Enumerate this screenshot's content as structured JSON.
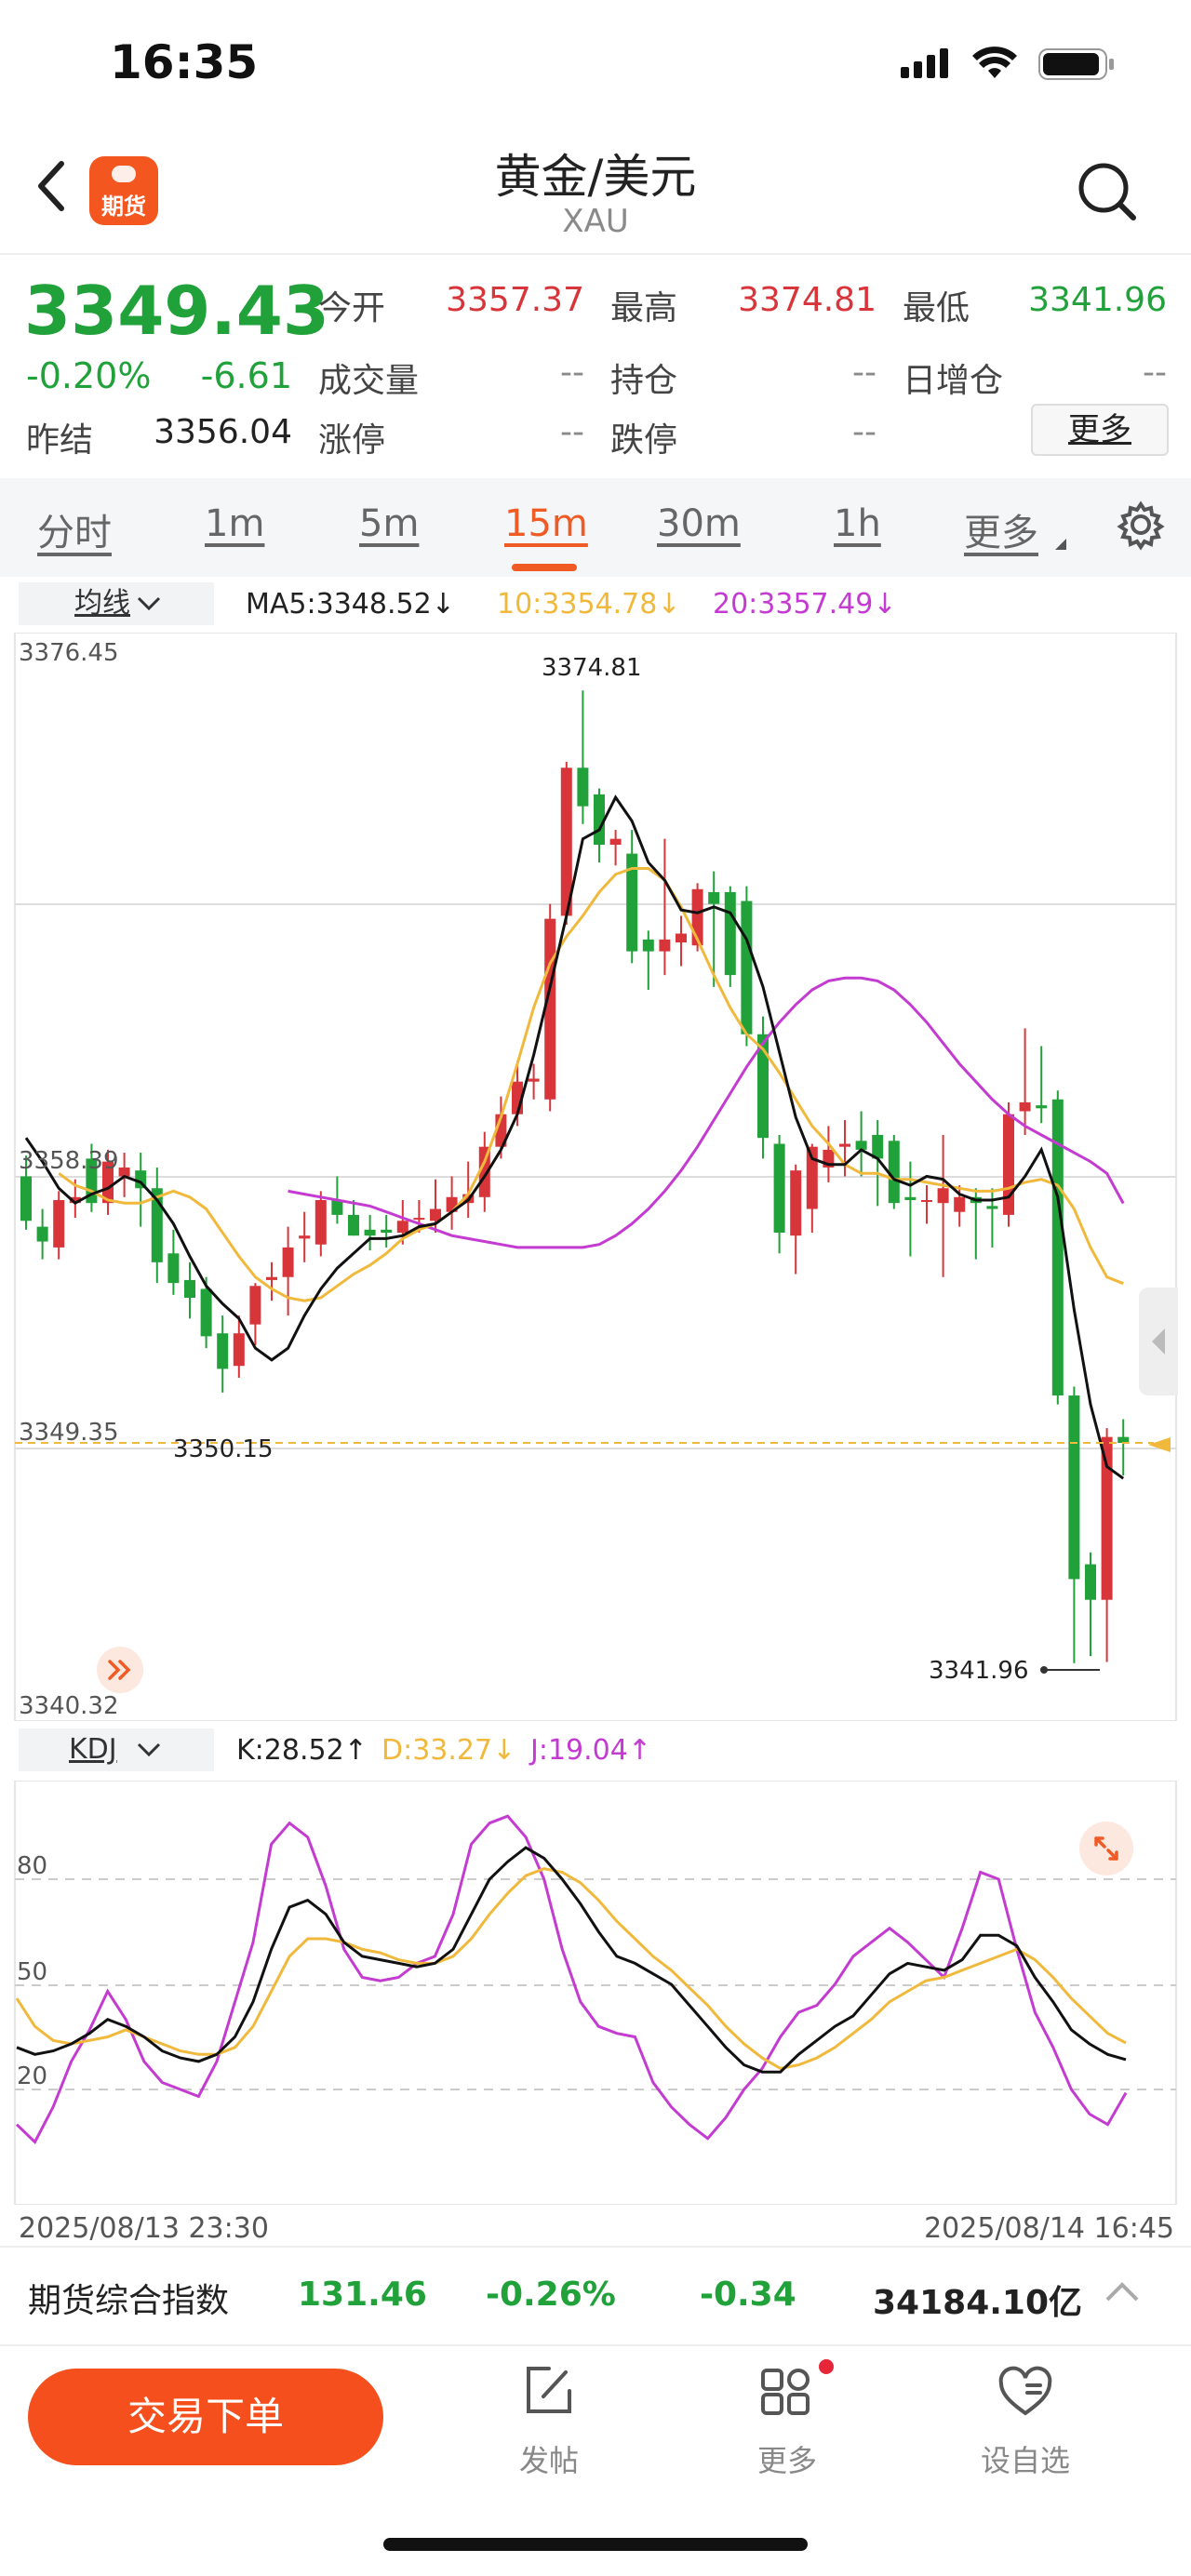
{
  "status_bar": {
    "time": "16:35"
  },
  "header": {
    "title": "黄金/美元",
    "subtitle": "XAU",
    "badge_label": "期货"
  },
  "quote": {
    "price": "3349.43",
    "change_pct": "-0.20%",
    "change": "-6.61",
    "prev_settle_label": "昨结",
    "prev_settle": "3356.04",
    "open_label": "今开",
    "open": "3357.37",
    "high_label": "最高",
    "high": "3374.81",
    "low_label": "最低",
    "low": "3341.96",
    "volume_label": "成交量",
    "volume": "--",
    "position_label": "持仓",
    "position": "--",
    "daily_inc_label": "日增仓",
    "daily_inc": "--",
    "limit_up_label": "涨停",
    "limit_up": "--",
    "limit_down_label": "跌停",
    "limit_down": "--",
    "more_label": "更多"
  },
  "tabs": [
    "分时",
    "1m",
    "5m",
    "15m",
    "30m",
    "1h",
    "更多"
  ],
  "active_tab": "15m",
  "main_chart": {
    "indicator_label": "均线",
    "ma5": "MA5:3348.52↓",
    "ma10": "10:3354.78↓",
    "ma20": "20:3357.49↓",
    "y_top": "3376.45",
    "y_mid": "3358.39",
    "y_low_ref": "3349.35",
    "y_bottom": "3340.32",
    "high_mark": "3374.81",
    "low_mark": "3341.96",
    "left_mark": "3350.15"
  },
  "sub_chart": {
    "indicator_label": "KDJ",
    "k": "K:28.52↑",
    "d": "D:33.27↓",
    "j": "J:19.04↑",
    "levels": [
      "80",
      "50",
      "20"
    ]
  },
  "time_axis": {
    "start": "2025/08/13 23:30",
    "end": "2025/08/14 16:45"
  },
  "index_bar": {
    "name": "期货综合指数",
    "value": "131.46",
    "pct": "-0.26%",
    "change": "-0.34",
    "turnover": "34184.10亿"
  },
  "bottom_nav": {
    "trade": "交易下单",
    "post": "发帖",
    "more": "更多",
    "watchlist": "设自选"
  },
  "colors": {
    "up": "#d8353a",
    "down": "#21a13a",
    "accent": "#f05a24",
    "ma10": "#f0b93c",
    "ma20": "#c43bd1"
  },
  "chart_data": [
    {
      "type": "candlestick",
      "title": "",
      "ylim": [
        3340.32,
        3376.45
      ],
      "candles": [
        {
          "o": 3358.4,
          "c": 3356.9,
          "h": 3359.1,
          "l": 3356.6
        },
        {
          "o": 3356.7,
          "c": 3356.2,
          "h": 3357.3,
          "l": 3355.6
        },
        {
          "o": 3356.0,
          "c": 3357.6,
          "h": 3357.9,
          "l": 3355.6
        },
        {
          "o": 3357.5,
          "c": 3357.7,
          "h": 3358.3,
          "l": 3357.0
        },
        {
          "o": 3359.0,
          "c": 3357.5,
          "h": 3359.5,
          "l": 3357.2
        },
        {
          "o": 3357.5,
          "c": 3358.9,
          "h": 3359.3,
          "l": 3357.1
        },
        {
          "o": 3358.4,
          "c": 3358.7,
          "h": 3359.2,
          "l": 3357.7
        },
        {
          "o": 3358.6,
          "c": 3358.0,
          "h": 3359.2,
          "l": 3356.7
        },
        {
          "o": 3358.0,
          "c": 3355.5,
          "h": 3358.7,
          "l": 3354.8
        },
        {
          "o": 3355.8,
          "c": 3354.8,
          "h": 3356.6,
          "l": 3354.4
        },
        {
          "o": 3354.9,
          "c": 3354.3,
          "h": 3355.5,
          "l": 3353.6
        },
        {
          "o": 3354.6,
          "c": 3353.0,
          "h": 3355.0,
          "l": 3352.6
        },
        {
          "o": 3353.1,
          "c": 3351.9,
          "h": 3353.7,
          "l": 3351.1
        },
        {
          "o": 3352.0,
          "c": 3353.1,
          "h": 3353.7,
          "l": 3351.6
        },
        {
          "o": 3353.4,
          "c": 3354.7,
          "h": 3354.8,
          "l": 3352.7
        },
        {
          "o": 3354.9,
          "c": 3355.0,
          "h": 3355.5,
          "l": 3354.2
        },
        {
          "o": 3355.0,
          "c": 3356.0,
          "h": 3356.7,
          "l": 3353.7
        },
        {
          "o": 3356.3,
          "c": 3356.4,
          "h": 3357.2,
          "l": 3355.5
        },
        {
          "o": 3356.1,
          "c": 3357.6,
          "h": 3357.9,
          "l": 3355.7
        },
        {
          "o": 3357.6,
          "c": 3357.1,
          "h": 3358.4,
          "l": 3356.8
        },
        {
          "o": 3357.1,
          "c": 3356.4,
          "h": 3357.6,
          "l": 3356.4
        },
        {
          "o": 3356.6,
          "c": 3356.4,
          "h": 3357.1,
          "l": 3355.9
        },
        {
          "o": 3356.6,
          "c": 3356.5,
          "h": 3357.1,
          "l": 3356.0
        },
        {
          "o": 3356.5,
          "c": 3356.9,
          "h": 3357.6,
          "l": 3356.1
        },
        {
          "o": 3357.0,
          "c": 3357.0,
          "h": 3357.6,
          "l": 3356.5
        },
        {
          "o": 3356.9,
          "c": 3357.3,
          "h": 3358.3,
          "l": 3356.5
        },
        {
          "o": 3357.2,
          "c": 3357.7,
          "h": 3358.4,
          "l": 3356.6
        },
        {
          "o": 3357.5,
          "c": 3357.8,
          "h": 3358.9,
          "l": 3357.0
        },
        {
          "o": 3357.7,
          "c": 3359.4,
          "h": 3359.9,
          "l": 3357.2
        },
        {
          "o": 3359.4,
          "c": 3360.5,
          "h": 3361.1,
          "l": 3359.0
        },
        {
          "o": 3360.5,
          "c": 3361.6,
          "h": 3362.3,
          "l": 3360.1
        },
        {
          "o": 3361.6,
          "c": 3361.7,
          "h": 3362.2,
          "l": 3361.0
        },
        {
          "o": 3361.0,
          "c": 3367.1,
          "h": 3367.6,
          "l": 3360.6
        },
        {
          "o": 3367.2,
          "c": 3372.2,
          "h": 3372.4,
          "l": 3366.9
        },
        {
          "o": 3372.2,
          "c": 3370.9,
          "h": 3374.81,
          "l": 3370.3
        },
        {
          "o": 3371.3,
          "c": 3369.6,
          "h": 3371.5,
          "l": 3369.0
        },
        {
          "o": 3369.6,
          "c": 3369.8,
          "h": 3370.1,
          "l": 3368.9
        },
        {
          "o": 3369.3,
          "c": 3366.0,
          "h": 3370.1,
          "l": 3365.6
        },
        {
          "o": 3366.4,
          "c": 3366.0,
          "h": 3366.7,
          "l": 3364.7
        },
        {
          "o": 3366.0,
          "c": 3366.4,
          "h": 3369.8,
          "l": 3365.2
        },
        {
          "o": 3366.3,
          "c": 3366.6,
          "h": 3367.2,
          "l": 3365.5
        },
        {
          "o": 3366.2,
          "c": 3368.1,
          "h": 3368.3,
          "l": 3366.0
        },
        {
          "o": 3368.0,
          "c": 3367.6,
          "h": 3368.7,
          "l": 3364.8
        },
        {
          "o": 3368.0,
          "c": 3365.2,
          "h": 3368.2,
          "l": 3364.8
        },
        {
          "o": 3367.7,
          "c": 3363.2,
          "h": 3368.2,
          "l": 3362.8
        },
        {
          "o": 3363.2,
          "c": 3359.7,
          "h": 3363.8,
          "l": 3359.0
        },
        {
          "o": 3359.5,
          "c": 3356.5,
          "h": 3359.8,
          "l": 3355.8
        },
        {
          "o": 3356.4,
          "c": 3358.6,
          "h": 3358.8,
          "l": 3355.1
        },
        {
          "o": 3357.3,
          "c": 3359.4,
          "h": 3359.5,
          "l": 3356.5
        },
        {
          "o": 3358.7,
          "c": 3359.3,
          "h": 3360.1,
          "l": 3358.2
        },
        {
          "o": 3359.4,
          "c": 3359.5,
          "h": 3360.3,
          "l": 3358.4
        },
        {
          "o": 3359.6,
          "c": 3359.3,
          "h": 3360.6,
          "l": 3358.4
        },
        {
          "o": 3359.8,
          "c": 3359.0,
          "h": 3360.3,
          "l": 3357.4
        },
        {
          "o": 3359.6,
          "c": 3357.5,
          "h": 3359.8,
          "l": 3357.3
        },
        {
          "o": 3357.7,
          "c": 3357.6,
          "h": 3358.9,
          "l": 3355.7
        },
        {
          "o": 3357.6,
          "c": 3357.6,
          "h": 3358.1,
          "l": 3356.8
        },
        {
          "o": 3357.5,
          "c": 3358.0,
          "h": 3359.8,
          "l": 3355.0
        },
        {
          "o": 3357.2,
          "c": 3357.7,
          "h": 3358.1,
          "l": 3356.7
        },
        {
          "o": 3357.7,
          "c": 3357.5,
          "h": 3358.0,
          "l": 3355.6
        },
        {
          "o": 3357.4,
          "c": 3357.3,
          "h": 3358.0,
          "l": 3356.0
        },
        {
          "o": 3357.1,
          "c": 3360.5,
          "h": 3360.9,
          "l": 3356.7
        },
        {
          "o": 3360.6,
          "c": 3360.9,
          "h": 3363.4,
          "l": 3359.8
        },
        {
          "o": 3360.8,
          "c": 3360.7,
          "h": 3362.8,
          "l": 3360.2
        },
        {
          "o": 3361.0,
          "c": 3351.0,
          "h": 3361.3,
          "l": 3350.7
        },
        {
          "o": 3351.0,
          "c": 3344.8,
          "h": 3351.3,
          "l": 3341.96
        },
        {
          "o": 3345.3,
          "c": 3344.1,
          "h": 3345.7,
          "l": 3342.2
        },
        {
          "o": 3344.1,
          "c": 3349.6,
          "h": 3349.9,
          "l": 3342.0
        },
        {
          "o": 3349.6,
          "c": 3349.4,
          "h": 3350.2,
          "l": 3348.3
        }
      ],
      "series": [
        {
          "name": "MA5",
          "values": [
            3359.7,
            3358.9,
            3358.0,
            3357.5,
            3357.8,
            3358.0,
            3358.4,
            3358.2,
            3357.6,
            3356.8,
            3355.7,
            3354.7,
            3354.1,
            3353.6,
            3352.6,
            3352.2,
            3352.6,
            3353.7,
            3354.6,
            3355.3,
            3355.8,
            3356.3,
            3356.3,
            3356.4,
            3356.7,
            3356.8,
            3357.2,
            3357.6,
            3358.4,
            3359.3,
            3360.5,
            3362.5,
            3364.8,
            3367.2,
            3369.8,
            3370.1,
            3371.2,
            3370.4,
            3369.0,
            3368.4,
            3367.4,
            3367.3,
            3367.5,
            3367.3,
            3366.4,
            3364.8,
            3362.6,
            3360.4,
            3359.0,
            3358.8,
            3358.8,
            3359.3,
            3359.0,
            3358.3,
            3358.1,
            3358.4,
            3358.3,
            3357.8,
            3357.6,
            3357.6,
            3357.7,
            3358.4,
            3359.3,
            3357.7,
            3353.9,
            3350.7,
            3348.6,
            3348.2
          ]
        },
        {
          "name": "MA10",
          "values": [
            3358.5,
            3358.1,
            3357.9,
            3357.6,
            3357.5,
            3357.5,
            3357.7,
            3357.9,
            3357.7,
            3357.3,
            3356.5,
            3355.7,
            3355.0,
            3354.6,
            3354.3,
            3354.2,
            3354.3,
            3354.7,
            3355.1,
            3355.4,
            3355.8,
            3356.3,
            3356.6,
            3356.8,
            3357.2,
            3357.8,
            3358.9,
            3360.4,
            3362.2,
            3364.1,
            3365.6,
            3366.5,
            3367.2,
            3368.0,
            3368.6,
            3368.8,
            3368.8,
            3368.4,
            3367.5,
            3366.4,
            3365.2,
            3364.1,
            3363.2,
            3362.7,
            3361.9,
            3361.0,
            3360.1,
            3359.5,
            3358.8,
            3358.5,
            3358.5,
            3358.3,
            3358.3,
            3358.2,
            3358.1,
            3358.0,
            3357.9,
            3357.9,
            3358.0,
            3358.2,
            3358.3,
            3358.1,
            3357.3,
            3356.0,
            3355.0,
            3354.78
          ]
        },
        {
          "name": "MA20",
          "values": [
            3357.9,
            3357.8,
            3357.7,
            3357.6,
            3357.5,
            3357.4,
            3357.2,
            3357.0,
            3356.8,
            3356.6,
            3356.4,
            3356.3,
            3356.2,
            3356.1,
            3356.0,
            3356.0,
            3356.0,
            3356.0,
            3356.0,
            3356.1,
            3356.4,
            3356.8,
            3357.3,
            3357.9,
            3358.6,
            3359.4,
            3360.3,
            3361.2,
            3362.1,
            3362.9,
            3363.6,
            3364.2,
            3364.7,
            3365.0,
            3365.1,
            3365.1,
            3365.0,
            3364.7,
            3364.2,
            3363.6,
            3362.9,
            3362.2,
            3361.6,
            3361.0,
            3360.5,
            3360.1,
            3359.8,
            3359.5,
            3359.2,
            3358.9,
            3358.5,
            3357.49
          ]
        }
      ]
    },
    {
      "type": "line",
      "title": "",
      "ylim": [
        0,
        100
      ],
      "series": [
        {
          "name": "K",
          "values": [
            32,
            30,
            31,
            33,
            36,
            40,
            38,
            35,
            31,
            29,
            28,
            30,
            35,
            45,
            60,
            72,
            74,
            70,
            62,
            58,
            57,
            56,
            55,
            56,
            60,
            70,
            80,
            85,
            89,
            86,
            80,
            73,
            65,
            58,
            56,
            53,
            50,
            44,
            38,
            32,
            27,
            25,
            25,
            30,
            34,
            38,
            41,
            47,
            53,
            56,
            55,
            54,
            57,
            64,
            64,
            61,
            52,
            45,
            37,
            33,
            30,
            28.52
          ]
        },
        {
          "name": "D",
          "values": [
            46,
            38,
            34,
            33,
            34,
            35,
            37,
            35,
            33,
            31,
            30,
            30,
            32,
            38,
            48,
            58,
            63,
            63,
            62,
            60,
            59,
            57,
            56,
            56,
            58,
            63,
            70,
            76,
            81,
            83,
            82,
            79,
            74,
            68,
            63,
            58,
            54,
            49,
            44,
            38,
            33,
            29,
            26,
            27,
            29,
            32,
            36,
            40,
            45,
            48,
            51,
            52,
            54,
            56,
            58,
            60,
            57,
            52,
            46,
            41,
            36,
            33.27
          ]
        },
        {
          "name": "J",
          "values": [
            10,
            5,
            15,
            28,
            37,
            48,
            40,
            28,
            22,
            20,
            18,
            28,
            45,
            62,
            90,
            96,
            92,
            78,
            60,
            52,
            51,
            52,
            56,
            58,
            70,
            90,
            96,
            98,
            92,
            80,
            60,
            45,
            38,
            36,
            35,
            22,
            15,
            10,
            6,
            12,
            20,
            26,
            35,
            42,
            44,
            50,
            58,
            62,
            66,
            62,
            57,
            52,
            66,
            82,
            80,
            60,
            42,
            32,
            20,
            13,
            10,
            19.04
          ]
        }
      ]
    }
  ]
}
